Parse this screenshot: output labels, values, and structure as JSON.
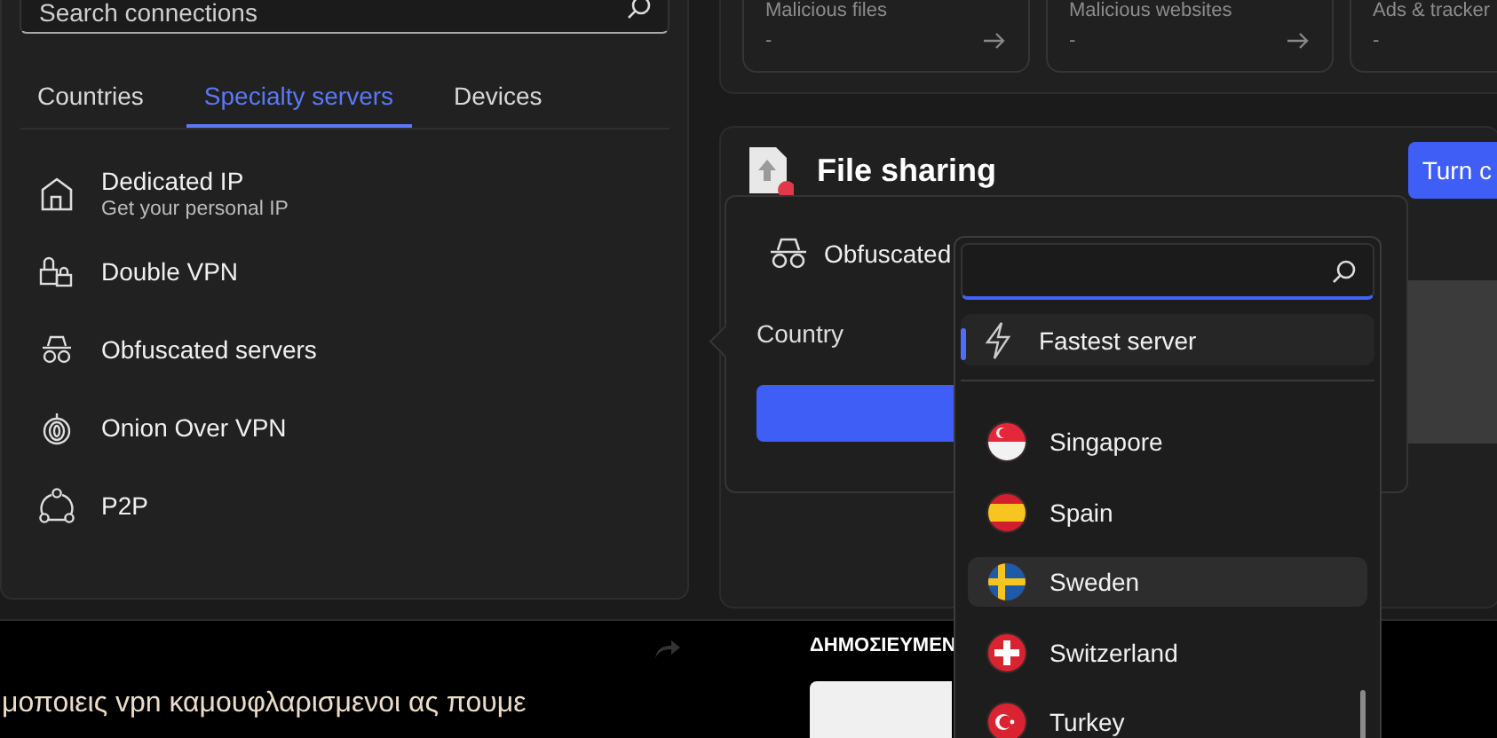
{
  "sidebar": {
    "search": {
      "placeholder": "Search connections"
    },
    "tabs": [
      {
        "label": "Countries",
        "selected": false
      },
      {
        "label": "Specialty servers",
        "selected": true
      },
      {
        "label": "Devices",
        "selected": false
      }
    ],
    "items": [
      {
        "title": "Dedicated IP",
        "subtitle": "Get your personal IP"
      },
      {
        "title": "Double VPN"
      },
      {
        "title": "Obfuscated servers"
      },
      {
        "title": "Onion Over VPN"
      },
      {
        "title": "P2P"
      }
    ]
  },
  "stats": [
    {
      "title": "Malicious files",
      "value": "-",
      "arrow": true
    },
    {
      "title": "Malicious websites",
      "value": "-",
      "arrow": true
    },
    {
      "title": "Ads & tracker",
      "value": "-"
    }
  ],
  "file_sharing": {
    "title": "File sharing",
    "button": "Turn c"
  },
  "popup": {
    "title": "Obfuscated",
    "country_label": "Country"
  },
  "dropdown": {
    "options": [
      {
        "kind": "fastest",
        "label": "Fastest server",
        "selected": true,
        "hovered": false
      },
      {
        "kind": "country",
        "label": "Singapore",
        "selected": false,
        "hovered": false
      },
      {
        "kind": "country",
        "label": "Spain",
        "selected": false,
        "hovered": false
      },
      {
        "kind": "country",
        "label": "Sweden",
        "selected": false,
        "hovered": true
      },
      {
        "kind": "country",
        "label": "Switzerland",
        "selected": false,
        "hovered": false
      },
      {
        "kind": "country",
        "label": "Turkey",
        "selected": false,
        "hovered": false
      }
    ]
  },
  "background_page": {
    "heading": "ΔΗΜΟΣΙΕΥΜΕΝ",
    "text": "μοποιεις vpn καμουφλαρισμενοι ας πουμε"
  }
}
